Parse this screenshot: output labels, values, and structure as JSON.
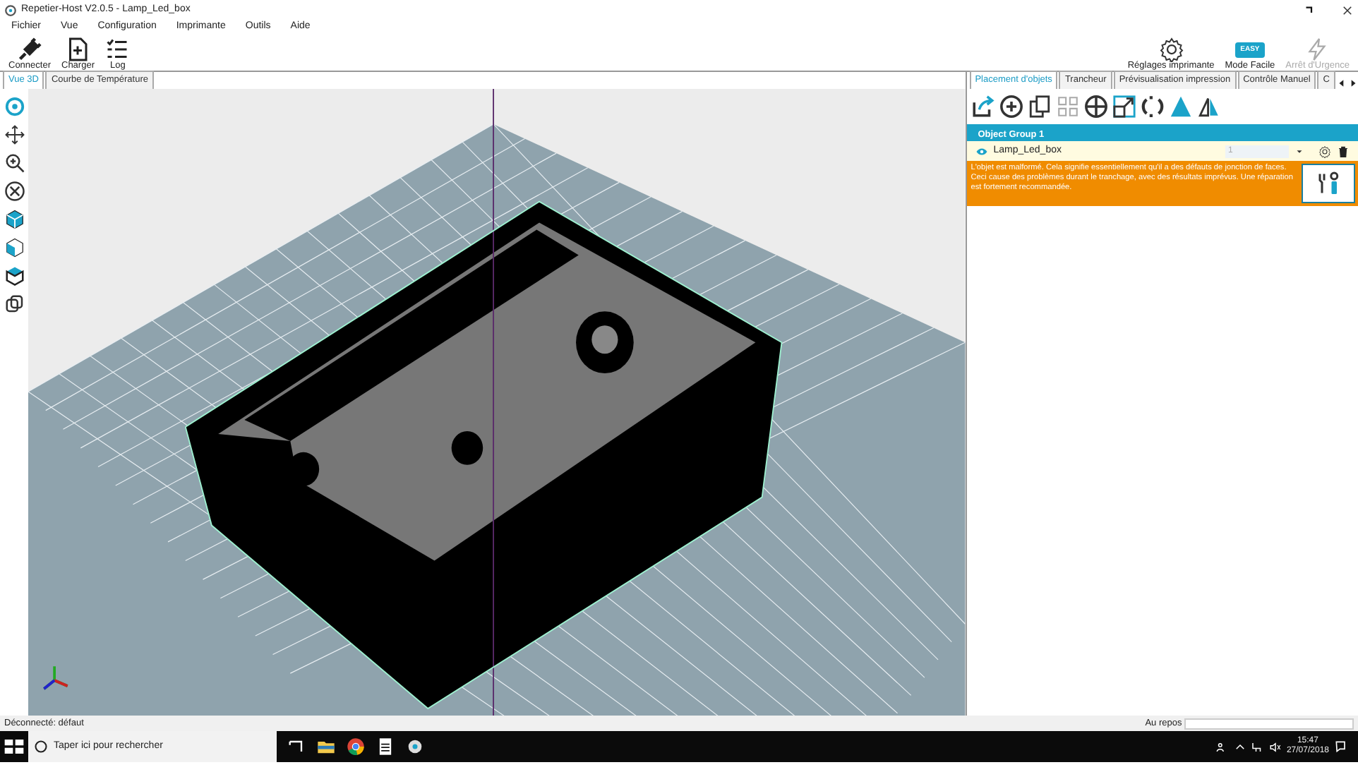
{
  "window": {
    "title": "Repetier-Host V2.0.5 - Lamp_Led_box"
  },
  "menu": [
    "Fichier",
    "Vue",
    "Configuration",
    "Imprimante",
    "Outils",
    "Aide"
  ],
  "toolbar": [
    {
      "label": "Connecter",
      "kind": "plug"
    },
    {
      "label": "Charger",
      "kind": "file"
    },
    {
      "label": "Log",
      "kind": "list"
    }
  ],
  "right_toolbar": [
    {
      "label": "Réglages imprimante",
      "kind": "gear",
      "disabled": false
    },
    {
      "label": "Mode Facile",
      "kind": "badge",
      "badge": "EASY",
      "disabled": false
    },
    {
      "label": "Arrêt d'Urgence",
      "kind": "bolt",
      "disabled": true
    }
  ],
  "view_tabs": [
    {
      "label": "Vue 3D",
      "selected": true
    },
    {
      "label": "Courbe de Température",
      "selected": false
    }
  ],
  "panel_tabs": [
    {
      "label": "Placement d'objets",
      "selected": true
    },
    {
      "label": "Trancheur",
      "selected": false
    },
    {
      "label": "Prévisualisation impression",
      "selected": false
    },
    {
      "label": "Contrôle Manuel",
      "selected": false
    },
    {
      "label": "C",
      "selected": false
    }
  ],
  "object_group": {
    "title": "Object Group 1"
  },
  "objects": [
    {
      "name": "Lamp_Led_box",
      "visible": true,
      "copies": "1"
    }
  ],
  "warning": "L'objet est malformé. Cela signifie essentiellement qu'il a des défauts de jonction de faces. Ceci cause des problèmes durant le tranchage, avec des résultats imprévus. Une réparation est fortement recommandée.",
  "status_bar": {
    "left": "Déconnecté: défaut",
    "right": "Au repos",
    "level": 0
  },
  "taskbar": {
    "search_placeholder": "Taper ici pour rechercher",
    "time": "15:47",
    "date": "27/07/2018"
  }
}
